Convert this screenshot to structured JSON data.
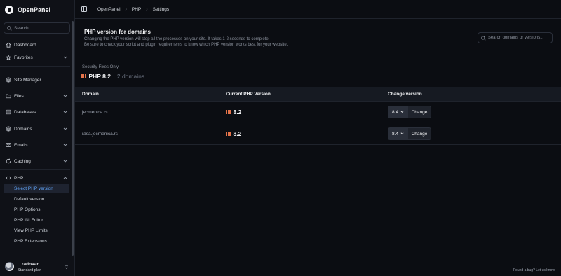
{
  "brand": {
    "name": "OpenPanel"
  },
  "search": {
    "placeholder": "Search..."
  },
  "sidebar": {
    "items": [
      {
        "label": "Dashboard",
        "icon": "home-icon"
      },
      {
        "label": "Favorites",
        "icon": "star-icon"
      },
      {
        "label": "Site Manager",
        "icon": "globe-icon"
      },
      {
        "label": "Files",
        "icon": "folder-icon"
      },
      {
        "label": "Databases",
        "icon": "database-icon"
      },
      {
        "label": "Domains",
        "icon": "globe-icon"
      },
      {
        "label": "Emails",
        "icon": "mail-icon"
      },
      {
        "label": "Caching",
        "icon": "refresh-icon"
      },
      {
        "label": "PHP",
        "icon": "code-icon"
      }
    ],
    "php_sub": [
      "Select PHP version",
      "Default version",
      "PHP Options",
      "PHP.INI Editor",
      "View PHP Limits",
      "PHP Extensions"
    ]
  },
  "user": {
    "name": "radovan",
    "plan": "Standard plan"
  },
  "breadcrumb": [
    "OpenPanel",
    "PHP",
    "Settings"
  ],
  "page": {
    "title": "PHP version for domains",
    "desc_1": "Changing the PHP version will stop all the processes on your site. It takes 1-2 seconds to complete.",
    "desc_2": "Be sure to check your script and plugin requirements to know which PHP version works best for your website.",
    "search_placeholder": "Search domains or versions..."
  },
  "group": {
    "label": "Security-Fixes Only",
    "version": "PHP 8.2",
    "separator": "·",
    "count": "2 domains"
  },
  "table": {
    "headers": [
      "Domain",
      "Current PHP Version",
      "Change version"
    ],
    "rows": [
      {
        "domain": "jecmenica.rs",
        "version": "8.2",
        "selected": "8.4",
        "button": "Change"
      },
      {
        "domain": "rasa.jecmenica.rs",
        "version": "8.2",
        "selected": "8.4",
        "button": "Change"
      }
    ]
  },
  "footer": {
    "link": "Found a bug? Let us know."
  },
  "colors": {
    "php_accent": "#e5734a",
    "active_nav": "#60a5fa",
    "background": "#0b0d12"
  }
}
